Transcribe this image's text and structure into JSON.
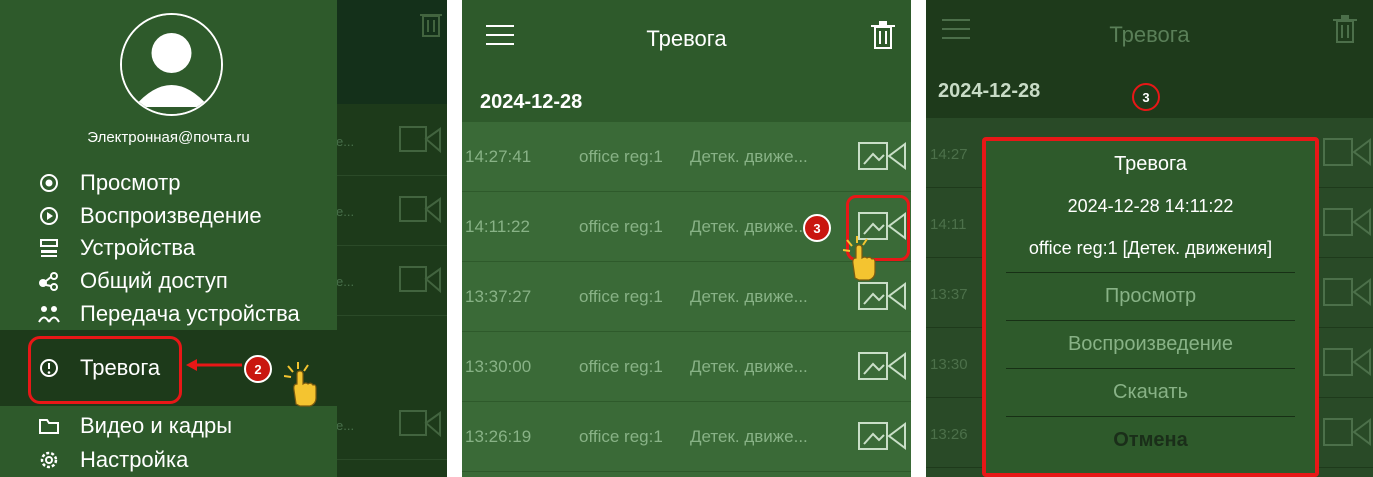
{
  "panel1": {
    "email": "Электронная@почта.ru",
    "menu": [
      {
        "label": "Просмотр",
        "icon": "view-icon"
      },
      {
        "label": "Воспроизведение",
        "icon": "play-circle-icon"
      },
      {
        "label": "Устройства",
        "icon": "devices-icon"
      },
      {
        "label": "Общий доступ",
        "icon": "share-icon"
      },
      {
        "label": "Передача устройства",
        "icon": "transfer-icon"
      },
      {
        "label": "Тревога",
        "icon": "alarm-icon"
      },
      {
        "label": "Видео и кадры",
        "icon": "folder-icon"
      },
      {
        "label": "Настройка",
        "icon": "settings-icon"
      }
    ],
    "step_badge": "2",
    "bg_row_text": "е..."
  },
  "panel2": {
    "title": "Тревога",
    "date": "2024-12-28",
    "rows": [
      {
        "time": "14:27:41",
        "device": "office reg:1",
        "kind": "Детек. движе..."
      },
      {
        "time": "14:11:22",
        "device": "office reg:1",
        "kind": "Детек. движе..."
      },
      {
        "time": "13:37:27",
        "device": "office reg:1",
        "kind": "Детек. движе..."
      },
      {
        "time": "13:30:00",
        "device": "office reg:1",
        "kind": "Детек. движе..."
      },
      {
        "time": "13:26:19",
        "device": "office reg:1",
        "kind": "Детек. движе..."
      }
    ],
    "step_badge": "3"
  },
  "panel3": {
    "title": "Тревога",
    "date": "2024-12-28",
    "step_badge": "3",
    "bg_times": [
      "14:27",
      "14:11",
      "13:37",
      "13:30",
      "13:26"
    ],
    "dialog": {
      "title": "Тревога",
      "datetime": "2024-12-28 14:11:22",
      "detail": "office reg:1 [Детек. движения]",
      "options": [
        "Просмотр",
        "Воспроизведение",
        "Скачать"
      ],
      "cancel": "Отмена"
    }
  },
  "colors": {
    "drawer": "#2e5a2b",
    "highlight": "#e81717",
    "badge": "#c9160f"
  }
}
